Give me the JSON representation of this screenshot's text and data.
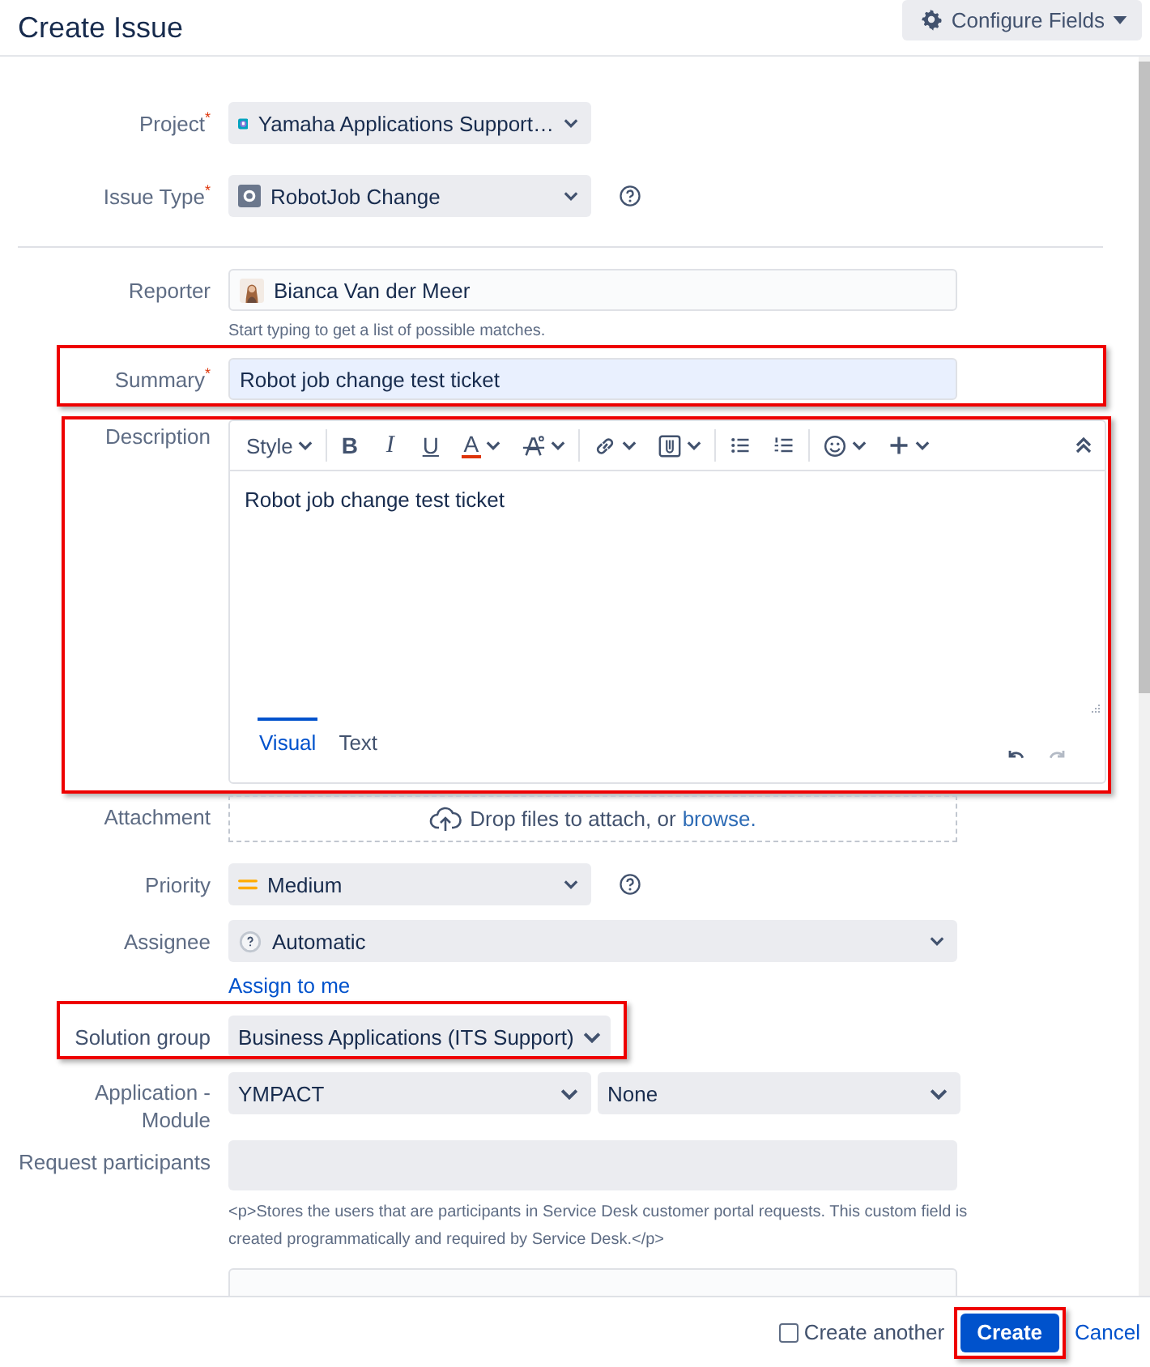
{
  "header": {
    "title": "Create Issue",
    "configure_button": "Configure Fields"
  },
  "project": {
    "label": "Project",
    "required_mark": "*",
    "value": "Yamaha Applications Support…"
  },
  "issue_type": {
    "label": "Issue Type",
    "required_mark": "*",
    "value": "RobotJob Change"
  },
  "reporter": {
    "label": "Reporter",
    "value": "Bianca Van der Meer",
    "hint": "Start typing to get a list of possible matches."
  },
  "summary": {
    "label": "Summary",
    "required_mark": "*",
    "value": "Robot job change test ticket",
    "highlighted": true
  },
  "description": {
    "label": "Description",
    "highlighted": true,
    "toolbar": [
      [
        {
          "kind": "style",
          "label": "Style",
          "caret": true
        }
      ],
      [
        {
          "kind": "bold",
          "label": "B",
          "caret": false
        },
        {
          "kind": "italic",
          "label": "I",
          "caret": false
        },
        {
          "kind": "underline",
          "label": "U",
          "caret": false
        },
        {
          "kind": "color",
          "label": "A",
          "caret": true
        },
        {
          "kind": "clear-format",
          "caret": true
        }
      ],
      [
        {
          "kind": "link",
          "caret": true
        },
        {
          "kind": "attachment",
          "caret": true
        }
      ],
      [
        {
          "kind": "bullets",
          "caret": false
        },
        {
          "kind": "numbers",
          "caret": false
        }
      ],
      [
        {
          "kind": "emoji",
          "caret": true
        },
        {
          "kind": "plus",
          "caret": true
        }
      ]
    ],
    "content": "Robot job change test ticket",
    "tabs": [
      {
        "label": "Visual",
        "selected": true
      },
      {
        "label": "Text",
        "selected": false
      }
    ]
  },
  "attachment": {
    "label": "Attachment",
    "text": "Drop files to attach, or",
    "link": "browse."
  },
  "priority": {
    "label": "Priority",
    "value": "Medium"
  },
  "assignee": {
    "label": "Assignee",
    "value": "Automatic",
    "link": "Assign to me"
  },
  "solution_group": {
    "label": "Solution group",
    "value": "Business Applications (ITS Support)",
    "highlighted": true
  },
  "application_module": {
    "label": "Application - Module",
    "values": [
      "YMPACT",
      "None"
    ]
  },
  "request_participants": {
    "label": "Request participants",
    "hint": "<p>Stores the users that are participants in Service Desk customer portal requests. This custom field is created programmatically and required by Service Desk.</p>"
  },
  "footer": {
    "create_another": {
      "label": "Create another",
      "checked": false
    },
    "create_button": {
      "label": "Create",
      "highlighted": true
    },
    "cancel": "Cancel"
  }
}
